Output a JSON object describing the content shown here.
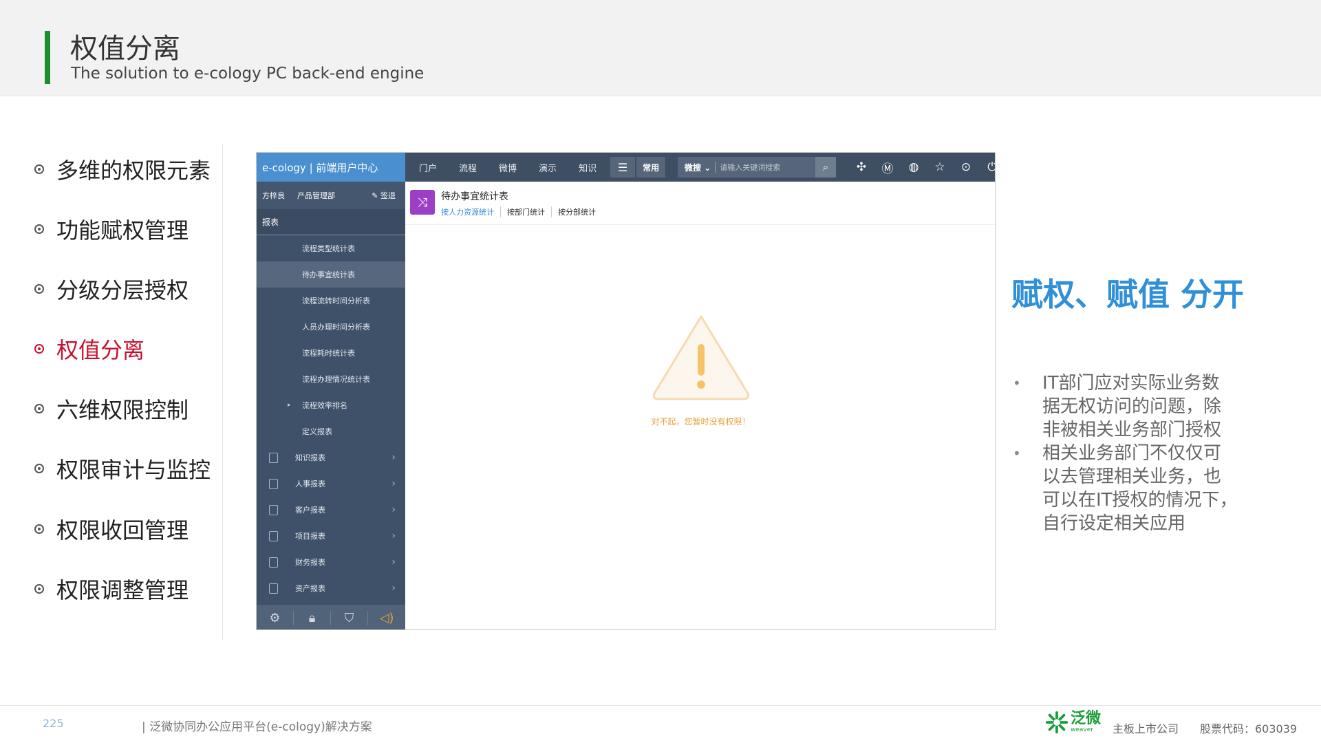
{
  "header": {
    "title": "权值分离",
    "subtitle": "The solution to e-cology PC back-end engine"
  },
  "menu": [
    {
      "label": "多维的权限元素",
      "active": false
    },
    {
      "label": "功能赋权管理",
      "active": false
    },
    {
      "label": "分级分层授权",
      "active": false
    },
    {
      "label": "权值分离",
      "active": true
    },
    {
      "label": "六维权限控制",
      "active": false
    },
    {
      "label": "权限审计与监控",
      "active": false
    },
    {
      "label": "权限收回管理",
      "active": false
    },
    {
      "label": "权限调整管理",
      "active": false
    }
  ],
  "app": {
    "brand": "e-cology | 前端用户中心",
    "nav": [
      "门户",
      "流程",
      "微博",
      "演示",
      "知识"
    ],
    "menu_icon": "hamburger-icon",
    "common_label": "常用",
    "search_scope": "微搜",
    "search_placeholder": "请输入关键词搜索",
    "top_icons": [
      "puzzle-icon",
      "m-circle-icon",
      "globe-icon",
      "star-icon",
      "more-icon",
      "power-icon"
    ],
    "user": {
      "name": "方梓良",
      "dept": "产品管理部",
      "sign": "签退"
    },
    "section_title": "报表",
    "sub_items": [
      {
        "label": "流程类型统计表",
        "active": false,
        "caret": false
      },
      {
        "label": "待办事宜统计表",
        "active": true,
        "caret": false
      },
      {
        "label": "流程流转时间分析表",
        "active": false,
        "caret": false
      },
      {
        "label": "人员办理时间分析表",
        "active": false,
        "caret": false
      },
      {
        "label": "流程耗时统计表",
        "active": false,
        "caret": false
      },
      {
        "label": "流程办理情况统计表",
        "active": false,
        "caret": false
      },
      {
        "label": "流程效率排名",
        "active": false,
        "caret": true
      },
      {
        "label": "定义报表",
        "active": false,
        "caret": false
      }
    ],
    "groups": [
      {
        "label": "知识报表"
      },
      {
        "label": "人事报表"
      },
      {
        "label": "客户报表"
      },
      {
        "label": "项目报表"
      },
      {
        "label": "财务报表"
      },
      {
        "label": "资产报表"
      }
    ],
    "bottom_icons": [
      "gear-icon",
      "lock-icon",
      "shirt-icon",
      "speaker-icon"
    ],
    "content": {
      "title": "待办事宜统计表",
      "tabs": [
        "按人力资源统计",
        "按部门统计",
        "按分部统计"
      ],
      "warning": "对不起，您暂时没有权限！",
      "accent": "#9b3fc4"
    }
  },
  "right": {
    "headline": "赋权、赋值 分开",
    "bullets": [
      {
        "lines": [
          "IT部门应对实际业务数",
          "据无权访问的问题，除",
          "非被相关业务部门授权"
        ]
      },
      {
        "lines": [
          "相关业务部门不仅仅可",
          "以去管理相关业务，也",
          "可以在IT授权的情况下，",
          "自行设定相关应用"
        ]
      }
    ]
  },
  "footer": {
    "page": "225",
    "text": "| 泛微协同办公应用平台(e-cology)解决方案",
    "brand": "泛微",
    "brand_sub": "weaver",
    "company": "主板上市公司",
    "stock": "股票代码：603039"
  },
  "colors": {
    "accent_green": "#1f8f2e",
    "active_red": "#c8102e",
    "headline_blue": "#2f8fd8"
  }
}
